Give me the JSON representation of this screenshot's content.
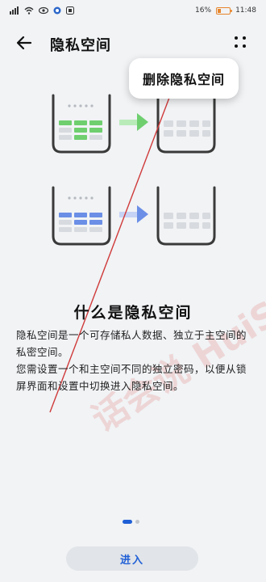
{
  "status_bar": {
    "battery_percent": "16%",
    "time": "11:48"
  },
  "header": {
    "title": "隐私空间"
  },
  "tooltip": {
    "label": "删除隐私空间"
  },
  "watermark": {
    "text": "话会说 HuiShuo.Com"
  },
  "content": {
    "section_title": "什么是隐私空间",
    "paragraph_1": "隐私空间是一个可存储私人数据、独立于主空间的私密空间。",
    "paragraph_2": "您需设置一个和主空间不同的独立密码，以便从锁屏界面和设置中切换进入隐私空间。"
  },
  "pager": {
    "current_page": 1,
    "total_pages": 2
  },
  "footer": {
    "enter_label": "进入"
  },
  "colors": {
    "accent": "#1f5fd6",
    "green_cell": "#6fcf6f",
    "blue_cell": "#6b8fe6",
    "gray_cell": "#d7dadf",
    "background": "#f1f3f5"
  }
}
